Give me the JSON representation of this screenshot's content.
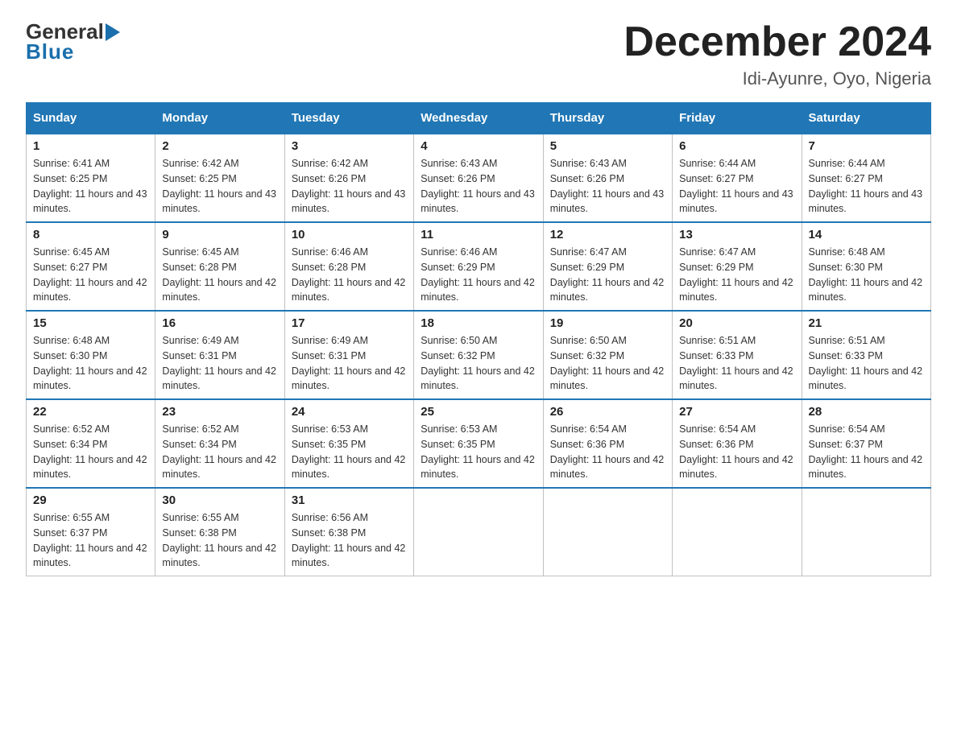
{
  "header": {
    "logo": {
      "general": "General",
      "blue": "Blue",
      "underline": "Blue"
    },
    "title": "December 2024",
    "location": "Idi-Ayunre, Oyo, Nigeria"
  },
  "calendar": {
    "days_of_week": [
      "Sunday",
      "Monday",
      "Tuesday",
      "Wednesday",
      "Thursday",
      "Friday",
      "Saturday"
    ],
    "weeks": [
      [
        {
          "day": "1",
          "sunrise": "6:41 AM",
          "sunset": "6:25 PM",
          "daylight": "11 hours and 43 minutes."
        },
        {
          "day": "2",
          "sunrise": "6:42 AM",
          "sunset": "6:25 PM",
          "daylight": "11 hours and 43 minutes."
        },
        {
          "day": "3",
          "sunrise": "6:42 AM",
          "sunset": "6:26 PM",
          "daylight": "11 hours and 43 minutes."
        },
        {
          "day": "4",
          "sunrise": "6:43 AM",
          "sunset": "6:26 PM",
          "daylight": "11 hours and 43 minutes."
        },
        {
          "day": "5",
          "sunrise": "6:43 AM",
          "sunset": "6:26 PM",
          "daylight": "11 hours and 43 minutes."
        },
        {
          "day": "6",
          "sunrise": "6:44 AM",
          "sunset": "6:27 PM",
          "daylight": "11 hours and 43 minutes."
        },
        {
          "day": "7",
          "sunrise": "6:44 AM",
          "sunset": "6:27 PM",
          "daylight": "11 hours and 43 minutes."
        }
      ],
      [
        {
          "day": "8",
          "sunrise": "6:45 AM",
          "sunset": "6:27 PM",
          "daylight": "11 hours and 42 minutes."
        },
        {
          "day": "9",
          "sunrise": "6:45 AM",
          "sunset": "6:28 PM",
          "daylight": "11 hours and 42 minutes."
        },
        {
          "day": "10",
          "sunrise": "6:46 AM",
          "sunset": "6:28 PM",
          "daylight": "11 hours and 42 minutes."
        },
        {
          "day": "11",
          "sunrise": "6:46 AM",
          "sunset": "6:29 PM",
          "daylight": "11 hours and 42 minutes."
        },
        {
          "day": "12",
          "sunrise": "6:47 AM",
          "sunset": "6:29 PM",
          "daylight": "11 hours and 42 minutes."
        },
        {
          "day": "13",
          "sunrise": "6:47 AM",
          "sunset": "6:29 PM",
          "daylight": "11 hours and 42 minutes."
        },
        {
          "day": "14",
          "sunrise": "6:48 AM",
          "sunset": "6:30 PM",
          "daylight": "11 hours and 42 minutes."
        }
      ],
      [
        {
          "day": "15",
          "sunrise": "6:48 AM",
          "sunset": "6:30 PM",
          "daylight": "11 hours and 42 minutes."
        },
        {
          "day": "16",
          "sunrise": "6:49 AM",
          "sunset": "6:31 PM",
          "daylight": "11 hours and 42 minutes."
        },
        {
          "day": "17",
          "sunrise": "6:49 AM",
          "sunset": "6:31 PM",
          "daylight": "11 hours and 42 minutes."
        },
        {
          "day": "18",
          "sunrise": "6:50 AM",
          "sunset": "6:32 PM",
          "daylight": "11 hours and 42 minutes."
        },
        {
          "day": "19",
          "sunrise": "6:50 AM",
          "sunset": "6:32 PM",
          "daylight": "11 hours and 42 minutes."
        },
        {
          "day": "20",
          "sunrise": "6:51 AM",
          "sunset": "6:33 PM",
          "daylight": "11 hours and 42 minutes."
        },
        {
          "day": "21",
          "sunrise": "6:51 AM",
          "sunset": "6:33 PM",
          "daylight": "11 hours and 42 minutes."
        }
      ],
      [
        {
          "day": "22",
          "sunrise": "6:52 AM",
          "sunset": "6:34 PM",
          "daylight": "11 hours and 42 minutes."
        },
        {
          "day": "23",
          "sunrise": "6:52 AM",
          "sunset": "6:34 PM",
          "daylight": "11 hours and 42 minutes."
        },
        {
          "day": "24",
          "sunrise": "6:53 AM",
          "sunset": "6:35 PM",
          "daylight": "11 hours and 42 minutes."
        },
        {
          "day": "25",
          "sunrise": "6:53 AM",
          "sunset": "6:35 PM",
          "daylight": "11 hours and 42 minutes."
        },
        {
          "day": "26",
          "sunrise": "6:54 AM",
          "sunset": "6:36 PM",
          "daylight": "11 hours and 42 minutes."
        },
        {
          "day": "27",
          "sunrise": "6:54 AM",
          "sunset": "6:36 PM",
          "daylight": "11 hours and 42 minutes."
        },
        {
          "day": "28",
          "sunrise": "6:54 AM",
          "sunset": "6:37 PM",
          "daylight": "11 hours and 42 minutes."
        }
      ],
      [
        {
          "day": "29",
          "sunrise": "6:55 AM",
          "sunset": "6:37 PM",
          "daylight": "11 hours and 42 minutes."
        },
        {
          "day": "30",
          "sunrise": "6:55 AM",
          "sunset": "6:38 PM",
          "daylight": "11 hours and 42 minutes."
        },
        {
          "day": "31",
          "sunrise": "6:56 AM",
          "sunset": "6:38 PM",
          "daylight": "11 hours and 42 minutes."
        },
        null,
        null,
        null,
        null
      ]
    ]
  }
}
